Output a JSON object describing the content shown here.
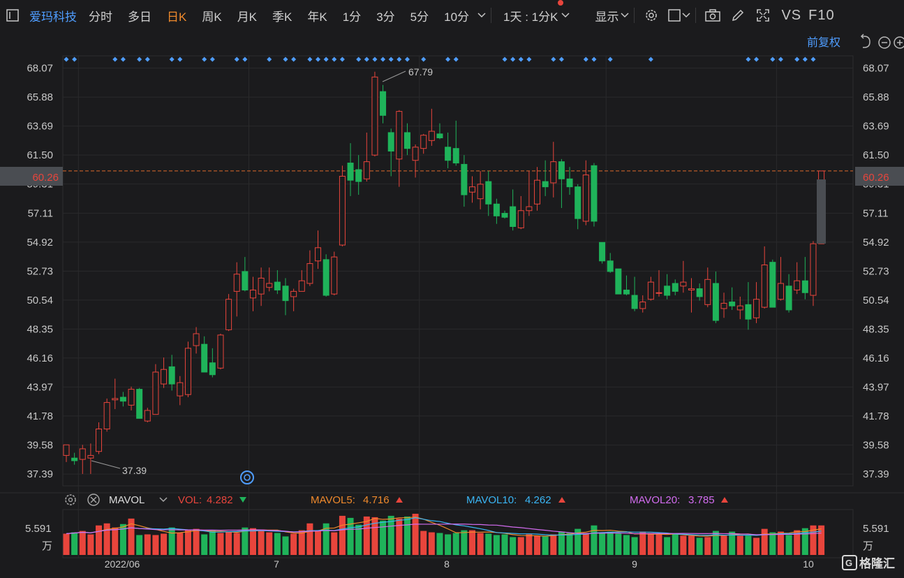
{
  "toolbar": {
    "stock_name": "爱玛科技",
    "periods": [
      "分时",
      "多日",
      "日K",
      "周K",
      "月K",
      "季K",
      "年K",
      "1分",
      "3分",
      "5分",
      "10分"
    ],
    "active_period": "日K",
    "multi_period": "1天 : 1分K",
    "display_label": "显示",
    "vs_label": "VS",
    "f10_label": "F10",
    "adjust_label": "前复权",
    "icons": [
      "menu-square-icon",
      "chevron-down-icon",
      "gear-icon",
      "box-icon",
      "camera-icon",
      "pencil-icon",
      "expand-icon",
      "undo-icon",
      "zoom-out-icon",
      "zoom-in-icon"
    ]
  },
  "price_axis": {
    "ticks": [
      "68.07",
      "65.88",
      "63.69",
      "61.50",
      "59.31",
      "57.11",
      "54.92",
      "52.73",
      "50.54",
      "48.35",
      "46.16",
      "43.97",
      "41.78",
      "39.58",
      "37.39"
    ],
    "current_price": "60.26",
    "high_label": "67.79",
    "low_label": "37.39"
  },
  "volume_panel": {
    "indicator": "MAVOL",
    "vol_label": "VOL:",
    "vol_value": "4.282",
    "ma5_label": "MAVOL5:",
    "ma5_value": "4.716",
    "ma10_label": "MAVOL10:",
    "ma10_value": "4.262",
    "ma20_label": "MAVOL20:",
    "ma20_value": "3.785",
    "axis_value": "5.591",
    "unit": "万"
  },
  "x_axis": {
    "labels": [
      "2022/06",
      "7",
      "8",
      "9",
      "10"
    ]
  },
  "watermark": "格隆汇",
  "colors": {
    "up": "#e8453c",
    "down": "#1fb35a",
    "accent": "#f08a2c",
    "blue": "#4f9dff",
    "mavol5": "#f08a2c",
    "mavol10": "#3ab6f5",
    "mavol20": "#d36cf0"
  },
  "chart_data": {
    "type": "candlestick",
    "ylim": [
      36.5,
      69.0
    ],
    "volume_ylim": [
      0,
      6.2
    ],
    "candles": [
      {
        "o": 38.8,
        "h": 39.6,
        "l": 38.3,
        "c": 39.6
      },
      {
        "o": 38.6,
        "h": 39.0,
        "l": 38.1,
        "c": 38.4
      },
      {
        "o": 38.5,
        "h": 39.6,
        "l": 37.4,
        "c": 39.3
      },
      {
        "o": 38.6,
        "h": 39.7,
        "l": 37.4,
        "c": 38.8
      },
      {
        "o": 39.1,
        "h": 41.3,
        "l": 38.9,
        "c": 40.8
      },
      {
        "o": 40.8,
        "h": 43.1,
        "l": 40.6,
        "c": 42.8
      },
      {
        "o": 43.0,
        "h": 44.6,
        "l": 42.3,
        "c": 43.1
      },
      {
        "o": 43.2,
        "h": 43.6,
        "l": 42.5,
        "c": 42.9
      },
      {
        "o": 42.6,
        "h": 44.0,
        "l": 42.2,
        "c": 43.8
      },
      {
        "o": 43.8,
        "h": 43.9,
        "l": 41.6,
        "c": 41.6
      },
      {
        "o": 41.4,
        "h": 42.4,
        "l": 41.3,
        "c": 42.2
      },
      {
        "o": 41.9,
        "h": 45.7,
        "l": 41.9,
        "c": 45.1
      },
      {
        "o": 44.2,
        "h": 46.2,
        "l": 43.9,
        "c": 45.3
      },
      {
        "o": 45.5,
        "h": 46.4,
        "l": 43.7,
        "c": 44.2
      },
      {
        "o": 43.3,
        "h": 44.8,
        "l": 42.6,
        "c": 44.3
      },
      {
        "o": 43.4,
        "h": 47.4,
        "l": 43.2,
        "c": 46.9
      },
      {
        "o": 47.1,
        "h": 48.5,
        "l": 46.5,
        "c": 48.0
      },
      {
        "o": 47.2,
        "h": 47.8,
        "l": 45.1,
        "c": 45.1
      },
      {
        "o": 45.8,
        "h": 46.9,
        "l": 44.7,
        "c": 44.9
      },
      {
        "o": 45.4,
        "h": 48.0,
        "l": 45.3,
        "c": 47.9
      },
      {
        "o": 48.3,
        "h": 51.0,
        "l": 48.2,
        "c": 50.6
      },
      {
        "o": 51.2,
        "h": 53.4,
        "l": 49.3,
        "c": 52.5
      },
      {
        "o": 52.7,
        "h": 53.8,
        "l": 51.2,
        "c": 51.3
      },
      {
        "o": 50.7,
        "h": 52.3,
        "l": 49.7,
        "c": 51.3
      },
      {
        "o": 51.0,
        "h": 53.0,
        "l": 50.1,
        "c": 52.2
      },
      {
        "o": 51.5,
        "h": 53.0,
        "l": 51.2,
        "c": 51.8
      },
      {
        "o": 51.9,
        "h": 52.8,
        "l": 51.0,
        "c": 51.3
      },
      {
        "o": 51.6,
        "h": 52.2,
        "l": 49.4,
        "c": 50.5
      },
      {
        "o": 50.8,
        "h": 51.4,
        "l": 49.7,
        "c": 51.2
      },
      {
        "o": 51.2,
        "h": 52.8,
        "l": 51.2,
        "c": 52.0
      },
      {
        "o": 51.8,
        "h": 54.3,
        "l": 51.6,
        "c": 53.3
      },
      {
        "o": 53.5,
        "h": 55.8,
        "l": 52.9,
        "c": 54.5
      },
      {
        "o": 53.6,
        "h": 54.0,
        "l": 50.8,
        "c": 50.9
      },
      {
        "o": 51.0,
        "h": 54.2,
        "l": 50.9,
        "c": 53.8
      },
      {
        "o": 54.7,
        "h": 60.7,
        "l": 54.6,
        "c": 59.9
      },
      {
        "o": 60.9,
        "h": 62.4,
        "l": 58.4,
        "c": 59.6
      },
      {
        "o": 60.4,
        "h": 61.5,
        "l": 58.5,
        "c": 59.5
      },
      {
        "o": 59.7,
        "h": 63.2,
        "l": 59.5,
        "c": 61.0
      },
      {
        "o": 61.5,
        "h": 67.8,
        "l": 61.4,
        "c": 67.4
      },
      {
        "o": 66.3,
        "h": 66.8,
        "l": 63.9,
        "c": 64.5
      },
      {
        "o": 63.2,
        "h": 63.5,
        "l": 59.9,
        "c": 61.8
      },
      {
        "o": 61.2,
        "h": 64.9,
        "l": 59.1,
        "c": 64.8
      },
      {
        "o": 63.2,
        "h": 63.9,
        "l": 61.5,
        "c": 62.0
      },
      {
        "o": 61.1,
        "h": 62.3,
        "l": 59.8,
        "c": 62.1
      },
      {
        "o": 62.0,
        "h": 63.1,
        "l": 61.6,
        "c": 63.0
      },
      {
        "o": 62.6,
        "h": 65.0,
        "l": 62.2,
        "c": 63.3
      },
      {
        "o": 63.1,
        "h": 63.9,
        "l": 62.7,
        "c": 62.8
      },
      {
        "o": 62.1,
        "h": 63.2,
        "l": 60.5,
        "c": 61.1
      },
      {
        "o": 62.0,
        "h": 64.1,
        "l": 60.7,
        "c": 60.9
      },
      {
        "o": 60.8,
        "h": 61.5,
        "l": 57.6,
        "c": 58.5
      },
      {
        "o": 58.7,
        "h": 59.9,
        "l": 57.9,
        "c": 59.1
      },
      {
        "o": 58.2,
        "h": 60.3,
        "l": 57.4,
        "c": 59.3
      },
      {
        "o": 59.5,
        "h": 60.3,
        "l": 56.9,
        "c": 57.8
      },
      {
        "o": 57.8,
        "h": 58.2,
        "l": 56.3,
        "c": 56.9
      },
      {
        "o": 57.1,
        "h": 57.3,
        "l": 56.7,
        "c": 56.8
      },
      {
        "o": 57.6,
        "h": 58.9,
        "l": 55.8,
        "c": 56.1
      },
      {
        "o": 56.0,
        "h": 58.4,
        "l": 55.9,
        "c": 57.3
      },
      {
        "o": 57.3,
        "h": 60.3,
        "l": 56.9,
        "c": 57.6
      },
      {
        "o": 57.8,
        "h": 60.6,
        "l": 57.3,
        "c": 59.6
      },
      {
        "o": 59.5,
        "h": 61.1,
        "l": 58.4,
        "c": 59.1
      },
      {
        "o": 59.4,
        "h": 62.5,
        "l": 58.3,
        "c": 61.0
      },
      {
        "o": 61.0,
        "h": 61.2,
        "l": 57.5,
        "c": 59.7
      },
      {
        "o": 59.7,
        "h": 60.6,
        "l": 58.5,
        "c": 59.1
      },
      {
        "o": 59.1,
        "h": 59.3,
        "l": 55.9,
        "c": 56.7
      },
      {
        "o": 56.5,
        "h": 61.1,
        "l": 56.2,
        "c": 60.0
      },
      {
        "o": 60.7,
        "h": 60.9,
        "l": 56.1,
        "c": 56.5
      },
      {
        "o": 54.9,
        "h": 54.9,
        "l": 53.3,
        "c": 53.5
      },
      {
        "o": 53.5,
        "h": 54.1,
        "l": 52.6,
        "c": 52.7
      },
      {
        "o": 52.9,
        "h": 52.9,
        "l": 51.0,
        "c": 51.0
      },
      {
        "o": 51.3,
        "h": 52.4,
        "l": 50.9,
        "c": 51.0
      },
      {
        "o": 50.9,
        "h": 52.3,
        "l": 49.7,
        "c": 49.9
      },
      {
        "o": 49.9,
        "h": 50.9,
        "l": 49.6,
        "c": 50.4
      },
      {
        "o": 50.6,
        "h": 52.3,
        "l": 50.5,
        "c": 51.9
      },
      {
        "o": 51.1,
        "h": 52.8,
        "l": 50.8,
        "c": 51.1
      },
      {
        "o": 51.6,
        "h": 52.5,
        "l": 50.6,
        "c": 50.9
      },
      {
        "o": 51.8,
        "h": 52.1,
        "l": 50.9,
        "c": 51.2
      },
      {
        "o": 51.6,
        "h": 53.5,
        "l": 51.1,
        "c": 51.9
      },
      {
        "o": 51.3,
        "h": 52.2,
        "l": 49.6,
        "c": 51.4
      },
      {
        "o": 51.4,
        "h": 51.8,
        "l": 50.5,
        "c": 50.8
      },
      {
        "o": 50.2,
        "h": 53.0,
        "l": 50.0,
        "c": 52.1
      },
      {
        "o": 51.8,
        "h": 52.7,
        "l": 48.8,
        "c": 49.0
      },
      {
        "o": 49.9,
        "h": 51.1,
        "l": 49.2,
        "c": 50.3
      },
      {
        "o": 50.4,
        "h": 51.5,
        "l": 49.8,
        "c": 50.1
      },
      {
        "o": 49.8,
        "h": 50.8,
        "l": 49.1,
        "c": 50.1
      },
      {
        "o": 50.2,
        "h": 51.9,
        "l": 48.3,
        "c": 49.1
      },
      {
        "o": 49.2,
        "h": 51.9,
        "l": 48.8,
        "c": 50.6
      },
      {
        "o": 50.0,
        "h": 54.6,
        "l": 49.9,
        "c": 53.2
      },
      {
        "o": 53.4,
        "h": 53.6,
        "l": 50.0,
        "c": 50.0
      },
      {
        "o": 50.6,
        "h": 53.8,
        "l": 50.5,
        "c": 51.8
      },
      {
        "o": 51.6,
        "h": 52.5,
        "l": 49.6,
        "c": 49.8
      },
      {
        "o": 51.3,
        "h": 53.4,
        "l": 51.0,
        "c": 52.0
      },
      {
        "o": 52.0,
        "h": 53.8,
        "l": 50.6,
        "c": 51.1
      },
      {
        "o": 50.9,
        "h": 55.0,
        "l": 50.1,
        "c": 54.8
      },
      {
        "o": 54.8,
        "h": 60.3,
        "l": 54.8,
        "c": 60.3
      }
    ],
    "volumes": [
      3.1,
      3.3,
      3.5,
      3.0,
      4.3,
      4.6,
      4.0,
      4.5,
      5.3,
      2.9,
      3.0,
      2.9,
      3.1,
      4.0,
      3.2,
      3.7,
      3.8,
      3.0,
      3.6,
      3.2,
      3.4,
      3.2,
      4.0,
      3.9,
      3.7,
      3.3,
      3.2,
      2.7,
      3.1,
      3.6,
      4.6,
      3.5,
      4.6,
      3.3,
      5.7,
      5.4,
      4.4,
      5.6,
      5.5,
      5.0,
      5.7,
      5.3,
      5.6,
      6.0,
      3.5,
      3.3,
      3.2,
      3.0,
      3.2,
      3.6,
      3.6,
      3.2,
      3.1,
      2.9,
      3.0,
      2.6,
      2.6,
      3.0,
      2.8,
      2.7,
      3.0,
      3.4,
      3.2,
      3.8,
      3.2,
      4.3,
      3.3,
      3.4,
      3.1,
      2.9,
      2.6,
      3.4,
      3.2,
      3.1,
      2.6,
      3.0,
      2.8,
      2.8,
      2.5,
      2.6,
      3.5,
      2.8,
      3.4,
      2.8,
      2.8,
      2.5,
      3.8,
      3.3,
      3.4,
      2.9,
      3.6,
      3.9,
      4.3,
      4.3
    ],
    "dot_markers": [
      0,
      1,
      6,
      7,
      9,
      10,
      13,
      14,
      17,
      18,
      21,
      22,
      25,
      27,
      28,
      30,
      31,
      32,
      33,
      34,
      36,
      37,
      38,
      39,
      40,
      41,
      42,
      44,
      47,
      48,
      54,
      55,
      56,
      57,
      60,
      61,
      64,
      65,
      67,
      72,
      84,
      85,
      87,
      88,
      90,
      91,
      92
    ]
  }
}
